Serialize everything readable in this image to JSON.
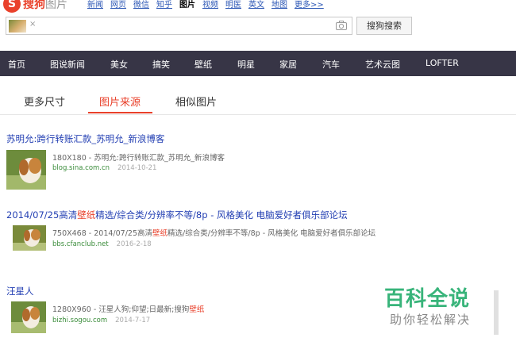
{
  "header": {
    "logo_text": "搜狗",
    "logo_suffix": "图片",
    "nav_links": [
      "新闻",
      "网页",
      "微信",
      "知乎",
      "图片",
      "视频",
      "明医",
      "英文",
      "地图",
      "更多>>"
    ],
    "active_link": "图片"
  },
  "search": {
    "button_label": "搜狗搜索",
    "chip_close": "×"
  },
  "categories": [
    "首页",
    "图说新闻",
    "美女",
    "搞笑",
    "壁纸",
    "明星",
    "家居",
    "汽车",
    "艺术云图",
    "LOFTER"
  ],
  "tabs": [
    "更多尺寸",
    "图片来源",
    "相似图片"
  ],
  "active_tab": "图片来源",
  "results": [
    {
      "title": "苏明允:跨行转账汇款_苏明允_新浪博客",
      "desc": "180X180 - 苏明允:跨行转账汇款_苏明允_新浪博客",
      "source": "blog.sina.com.cn",
      "date": "2014-10-21"
    },
    {
      "title_a": "2014/07/25高清",
      "title_hl": "壁纸",
      "title_b": "精选/综合类/分辨率不等/8p - 风格美化 电脑爱好者俱乐部论坛",
      "desc_a": "750X468 - 2014/07/25高清",
      "desc_hl": "壁纸",
      "desc_b": "精选/综合类/分辨率不等/8p - 风格美化 电脑爱好者俱乐部论坛",
      "source": "bbs.cfanclub.net",
      "date": "2016-2-18"
    },
    {
      "title": "汪星人",
      "desc_a": "1280X960 - 汪星人狗;仰望;日最新;搜狗",
      "desc_hl": "壁纸",
      "source": "bizhi.sogou.com",
      "date": "2014-7-17"
    }
  ],
  "watermark": {
    "main": "百科全说",
    "sub": "助你轻松解决"
  },
  "colors": {
    "brand_red": "#e9412b",
    "catbar_bg": "#373546",
    "link_blue": "#2440b3",
    "source_green": "#3a8c3a",
    "watermark_green": "#38b47a"
  }
}
